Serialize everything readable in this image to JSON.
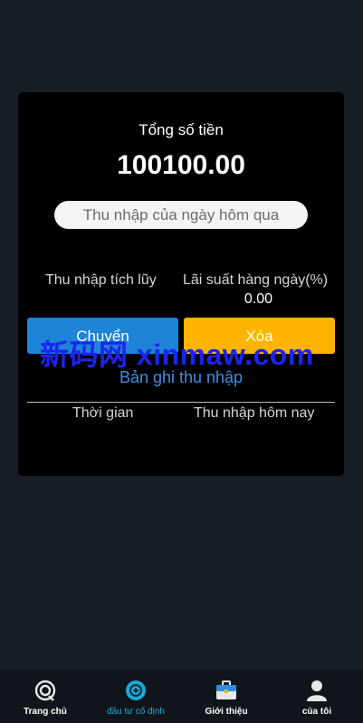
{
  "card": {
    "total_label": "Tổng số tiền",
    "total_value": "100100.00",
    "yesterday_label": "Thu nhập của ngày hôm qua",
    "cumulative_label": "Thu nhập tích lũy",
    "daily_rate_label": "Lãi suất hàng ngày(%)",
    "daily_rate_value": "0.00",
    "transfer_button": "Chuyển",
    "delete_button": "Xóa",
    "records_link": "Bản ghi thu nhập",
    "columns": [
      "Thời gian",
      "Thu nhập hôm nay"
    ]
  },
  "watermark": "新码网 xinmaw.com",
  "tabbar": {
    "items": [
      {
        "label": "Trang chủ",
        "icon": "home-icon"
      },
      {
        "label": "đầu tư cố định",
        "icon": "fixed-investment-icon",
        "active": true
      },
      {
        "label": "Giới thiệu",
        "icon": "briefcase-icon"
      },
      {
        "label": "của tôi",
        "icon": "user-icon"
      }
    ]
  },
  "colors": {
    "background": "#171d25",
    "card": "#000000",
    "primary": "#1d84d8",
    "warning": "#ffb400",
    "active_tab": "#1fa8d8"
  }
}
